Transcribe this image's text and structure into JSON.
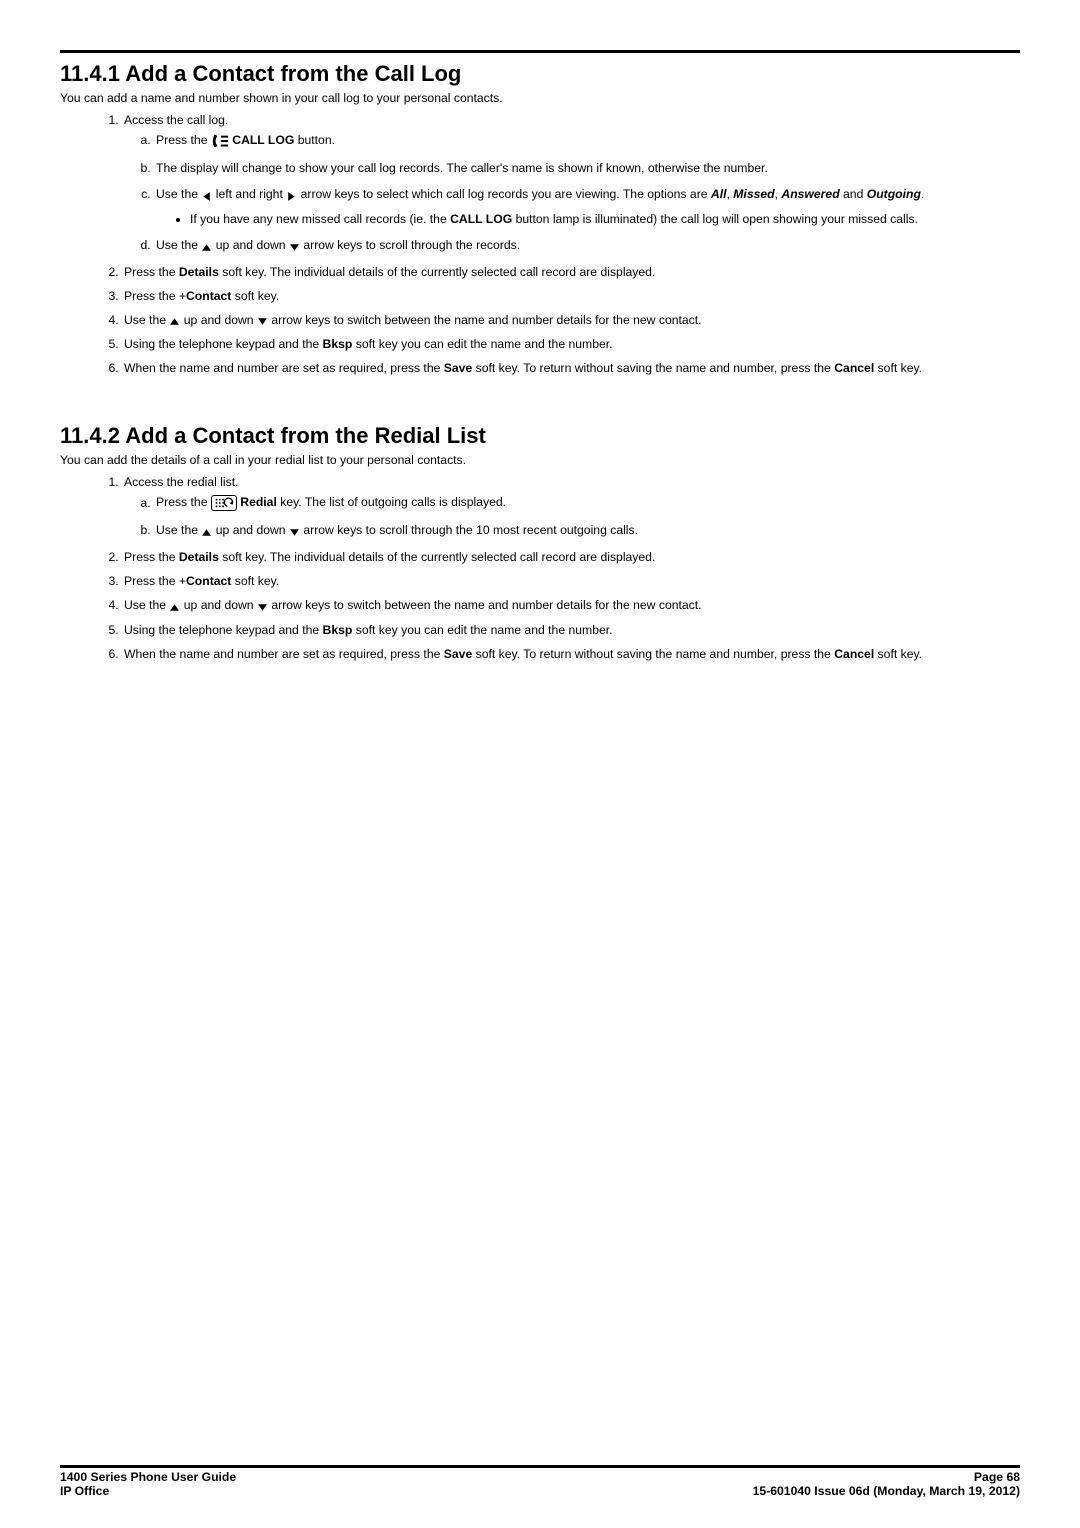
{
  "sec1": {
    "title": "11.4.1 Add a Contact from the Call Log",
    "intro": "You can add a name and number shown in your call log to your personal contacts.",
    "li1": "Access the call log.",
    "a_pre": "Press the ",
    "a_btn": " CALL LOG",
    "a_post": " button.",
    "b": "The display will change to show your call log records. The caller's name is shown if known, otherwise the number.",
    "c1": "Use the ",
    "c2": " left and right ",
    "c3": " arrow keys to select which call log records you are viewing. The options are ",
    "c_all": "All",
    "c_comma": ", ",
    "c_missed": "Missed",
    "c_sep": ", ",
    "c_answered": "Answered",
    "c_and": " and ",
    "c_outgoing": "Outgoing",
    "c_period": ".",
    "c_bullet1a": "If you have any new missed call records (ie. the ",
    "c_bullet1b": "CALL LOG",
    "c_bullet1c": " button lamp is illuminated) the call log will open showing your missed calls.",
    "d1": "Use the ",
    "d2": " up and down ",
    "d3": " arrow keys to scroll through the records.",
    "li2a": "Press the ",
    "li2b": "Details",
    "li2c": " soft key. The individual details of the currently selected call record are displayed.",
    "li3a": "Press the +",
    "li3b": "Contact",
    "li3c": " soft key.",
    "li4a": "Use the ",
    "li4b": " up and down ",
    "li4c": " arrow keys to switch between the name and number details for the new contact.",
    "li5a": "Using the telephone keypad and the ",
    "li5b": "Bksp",
    "li5c": " soft key you can edit the name and the number.",
    "li6a": "When the name and number are set as required, press the ",
    "li6b": "Save",
    "li6c": " soft key. To return without saving the name and number, press the ",
    "li6d": "Cancel",
    "li6e": " soft key."
  },
  "sec2": {
    "title": "11.4.2 Add a Contact from the Redial List",
    "intro": "You can add the details of a call in your redial list to your personal contacts.",
    "li1": "Access the redial list.",
    "a_pre": "Press the ",
    "a_mid": " Redial",
    "a_post": " key. The list of outgoing calls is displayed.",
    "b1": "Use the ",
    "b2": " up and down ",
    "b3": " arrow keys to scroll through the 10 most recent outgoing calls.",
    "li2a": "Press the ",
    "li2b": "Details",
    "li2c": " soft key. The individual details of the currently selected call record are displayed.",
    "li3a": "Press the +",
    "li3b": "Contact",
    "li3c": " soft key.",
    "li4a": "Use the ",
    "li4b": " up and down ",
    "li4c": " arrow keys to switch between the name and number details for the new contact.",
    "li5a": "Using the telephone keypad and the ",
    "li5b": "Bksp",
    "li5c": " soft key you can edit the name and the number.",
    "li6a": "When the name and number are set as required, press the ",
    "li6b": "Save",
    "li6c": " soft key. To return without saving the name and number, press the ",
    "li6d": "Cancel",
    "li6e": " soft key."
  },
  "footer": {
    "left1": "1400 Series Phone User Guide",
    "left2": "IP Office",
    "right1": "Page 68",
    "right2": "15-601040 Issue 06d (Monday, March 19, 2012)"
  }
}
